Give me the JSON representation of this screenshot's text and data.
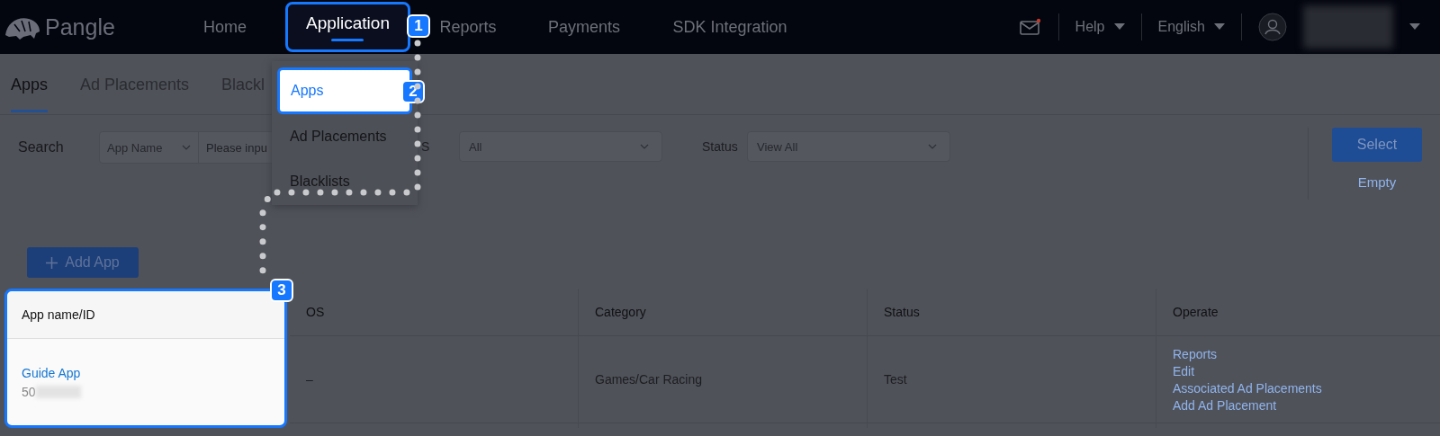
{
  "nav": {
    "logo": "Pangle",
    "items": [
      {
        "label": "Home",
        "selected": false
      },
      {
        "label": "Application",
        "selected": true,
        "callout": "1"
      },
      {
        "label": "Reports",
        "selected": false
      },
      {
        "label": "Payments",
        "selected": false
      },
      {
        "label": "SDK Integration",
        "selected": false
      }
    ],
    "mail": {
      "unread": true
    },
    "menus": [
      "Help",
      "English"
    ]
  },
  "subtabs": [
    {
      "label": "Apps",
      "selected": true
    },
    {
      "label": "Ad Placements",
      "selected": false
    },
    {
      "label": "Blackl",
      "selected": false
    }
  ],
  "search": {
    "label": "Search",
    "field_type": "App Name",
    "placeholder": "Please inpu",
    "filters": [
      {
        "label": "S",
        "value": "All"
      },
      {
        "label": "Status",
        "value": "View All"
      }
    ],
    "select_button": "Select",
    "empty_link": "Empty"
  },
  "dropdown": {
    "items": [
      {
        "label": "Apps",
        "selected": true,
        "callout": "2"
      },
      {
        "label": "Ad Placements",
        "selected": false
      },
      {
        "label": "Blacklists",
        "selected": false
      }
    ]
  },
  "add_button": "Add App",
  "table": {
    "columns": [
      {
        "label": "App name/ID",
        "callout": "3"
      },
      {
        "label": "OS"
      },
      {
        "label": "Category"
      },
      {
        "label": "Status"
      },
      {
        "label": "Operate"
      }
    ],
    "rows": [
      {
        "name": "Guide App",
        "id": "50",
        "os": "–",
        "category": "Games/Car Racing",
        "status": "Test",
        "operations": [
          "Reports",
          "Edit",
          "Associated Ad Placements",
          "Add Ad Placement"
        ]
      }
    ]
  }
}
